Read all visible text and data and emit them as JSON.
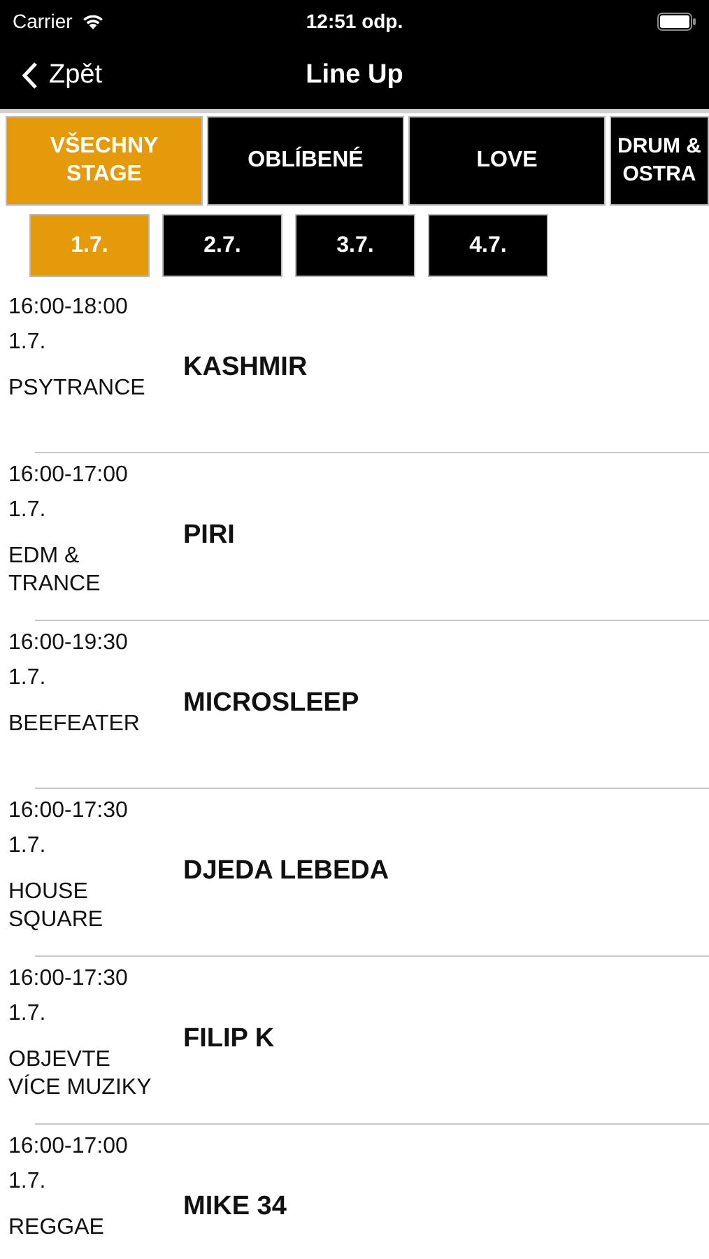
{
  "status_bar": {
    "carrier": "Carrier",
    "time": "12:51 odp."
  },
  "nav": {
    "back": "Zpět",
    "title": "Line Up"
  },
  "stages": [
    {
      "label": "VŠECHNY STAGE",
      "selected": true
    },
    {
      "label": "OBLÍBENÉ",
      "selected": false
    },
    {
      "label": "LOVE",
      "selected": false
    },
    {
      "label": "DRUM & OSTRA",
      "selected": false
    }
  ],
  "days": [
    {
      "label": "1.7.",
      "selected": true
    },
    {
      "label": "2.7.",
      "selected": false
    },
    {
      "label": "3.7.",
      "selected": false
    },
    {
      "label": "4.7.",
      "selected": false
    }
  ],
  "performances": [
    {
      "time": "16:00-18:00",
      "date": "1.7.",
      "stage": "PSYTRANCE",
      "artist": "KASHMIR"
    },
    {
      "time": "16:00-17:00",
      "date": "1.7.",
      "stage": "EDM & TRANCE",
      "artist": "PIRI"
    },
    {
      "time": "16:00-19:30",
      "date": "1.7.",
      "stage": "BEEFEATER",
      "artist": "MICROSLEEP"
    },
    {
      "time": "16:00-17:30",
      "date": "1.7.",
      "stage": "HOUSE SQUARE",
      "artist": "DJEDA LEBEDA"
    },
    {
      "time": "16:00-17:30",
      "date": "1.7.",
      "stage": "OBJEVTE VÍCE MUZIKY",
      "artist": "FILIP K"
    },
    {
      "time": "16:00-17:00",
      "date": "1.7.",
      "stage": "REGGAE",
      "artist": "MIKE 34"
    }
  ]
}
